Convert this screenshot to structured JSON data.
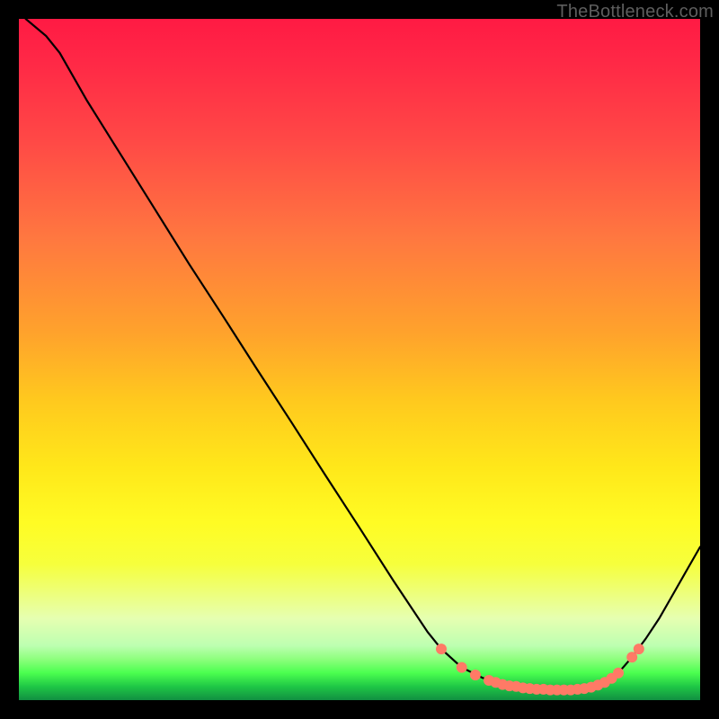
{
  "watermark": {
    "text": "TheBottleneck.com"
  },
  "colors": {
    "line": "#000000",
    "marker_fill": "#ff7a66",
    "marker_stroke": "#d15a4a"
  },
  "chart_data": {
    "type": "line",
    "title": "",
    "xlabel": "",
    "ylabel": "",
    "xlim": [
      0,
      100
    ],
    "ylim": [
      0,
      100
    ],
    "grid": false,
    "series": [
      {
        "name": "curve",
        "x": [
          1,
          4,
          6,
          10,
          15,
          20,
          25,
          30,
          35,
          40,
          45,
          50,
          55,
          60,
          62,
          65,
          68,
          70,
          72,
          74,
          76,
          78,
          80,
          82,
          84,
          86,
          88,
          90,
          92,
          94,
          96,
          98,
          100
        ],
        "y": [
          100,
          97.5,
          95,
          88,
          80,
          72,
          64,
          56.3,
          48.5,
          40.8,
          33,
          25.3,
          17.5,
          10,
          7.5,
          4.8,
          3.3,
          2.6,
          2.1,
          1.8,
          1.6,
          1.5,
          1.5,
          1.6,
          1.9,
          2.6,
          4,
          6.3,
          9,
          12,
          15.5,
          19,
          22.5
        ]
      }
    ],
    "markers": {
      "name": "highlight-points",
      "x": [
        62,
        65,
        67,
        69,
        70,
        71,
        72,
        73,
        74,
        75,
        76,
        77,
        78,
        79,
        80,
        81,
        82,
        83,
        84,
        85,
        86,
        87,
        88,
        90,
        91
      ],
      "y": [
        7.5,
        4.8,
        3.7,
        2.9,
        2.6,
        2.3,
        2.1,
        2.0,
        1.8,
        1.7,
        1.6,
        1.6,
        1.5,
        1.5,
        1.5,
        1.5,
        1.6,
        1.7,
        1.9,
        2.2,
        2.6,
        3.2,
        4.0,
        6.3,
        7.5
      ]
    }
  }
}
